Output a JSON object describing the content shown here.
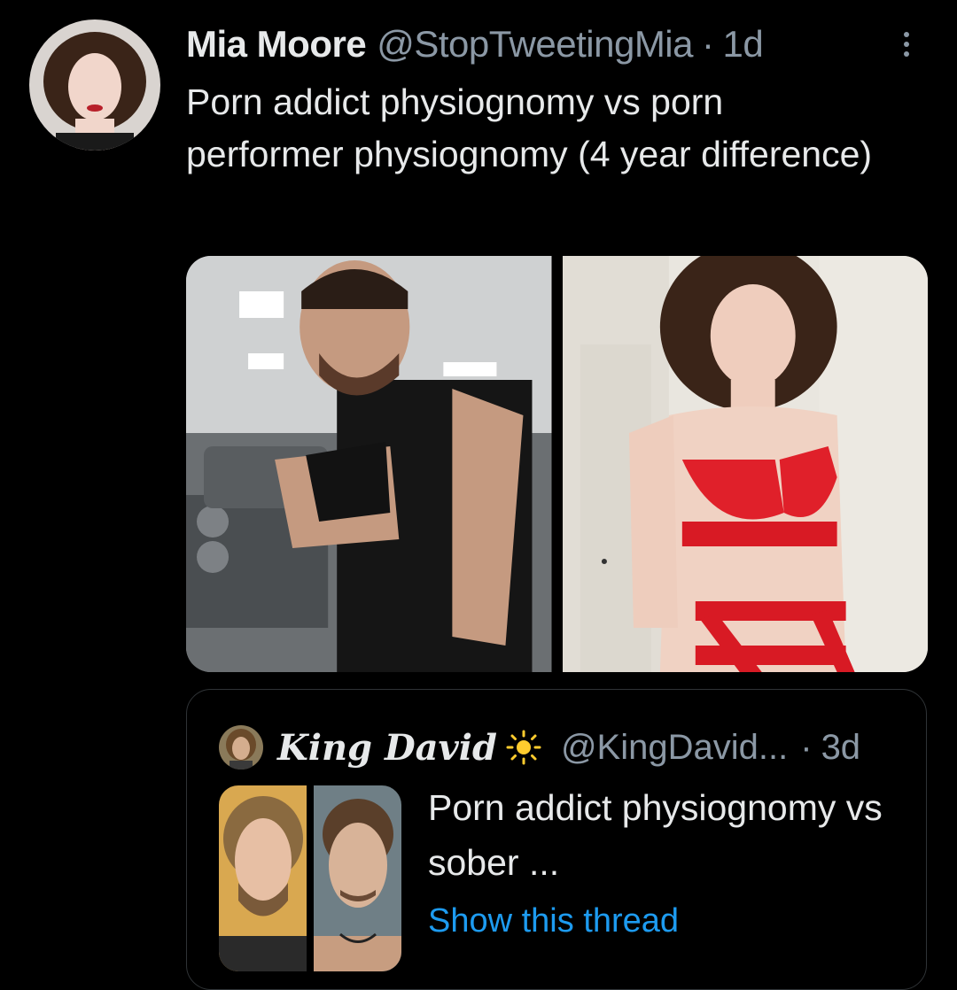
{
  "tweet": {
    "author": {
      "display_name": "Mia Moore",
      "handle": "@StopTweetingMia",
      "avatar_icon": "profile-photo"
    },
    "separator": "·",
    "time": "1d",
    "text": "Porn addict physiognomy vs porn performer physiognomy (4 year difference)",
    "media": [
      {
        "icon": "gym-selfie-photo"
      },
      {
        "icon": "red-lingerie-photo"
      }
    ],
    "more_icon": "more-horizontal-icon"
  },
  "quote": {
    "author": {
      "display_name": "King David",
      "badge_icon": "sun-icon",
      "handle": "@KingDavid...",
      "avatar_icon": "profile-photo"
    },
    "separator": "·",
    "time": "3d",
    "text": "Porn addict physiognomy vs sober ...",
    "thumbnail_icon": "before-after-photo",
    "link_label": "Show this thread"
  },
  "colors": {
    "background": "#000000",
    "text_primary": "#e7e9ea",
    "text_secondary": "#8b98a5",
    "link": "#1d9bf0",
    "border": "#2f3336"
  }
}
